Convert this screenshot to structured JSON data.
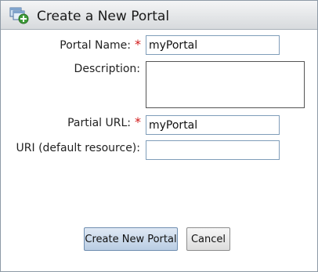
{
  "dialog": {
    "title": "Create a New Portal",
    "title_icon": "add-portal-icon"
  },
  "form": {
    "portal_name": {
      "label": "Portal Name:",
      "required_mark": "*",
      "value": "myPortal"
    },
    "description": {
      "label": "Description:",
      "value": ""
    },
    "partial_url": {
      "label": "Partial URL:",
      "required_mark": "*",
      "value": "myPortal"
    },
    "uri": {
      "label": "URI (default resource):",
      "value": ""
    }
  },
  "buttons": {
    "create_label": "Create New Portal",
    "cancel_label": "Cancel"
  },
  "colors": {
    "required": "#d21a1a",
    "primary_button": "#c9d9eb"
  }
}
